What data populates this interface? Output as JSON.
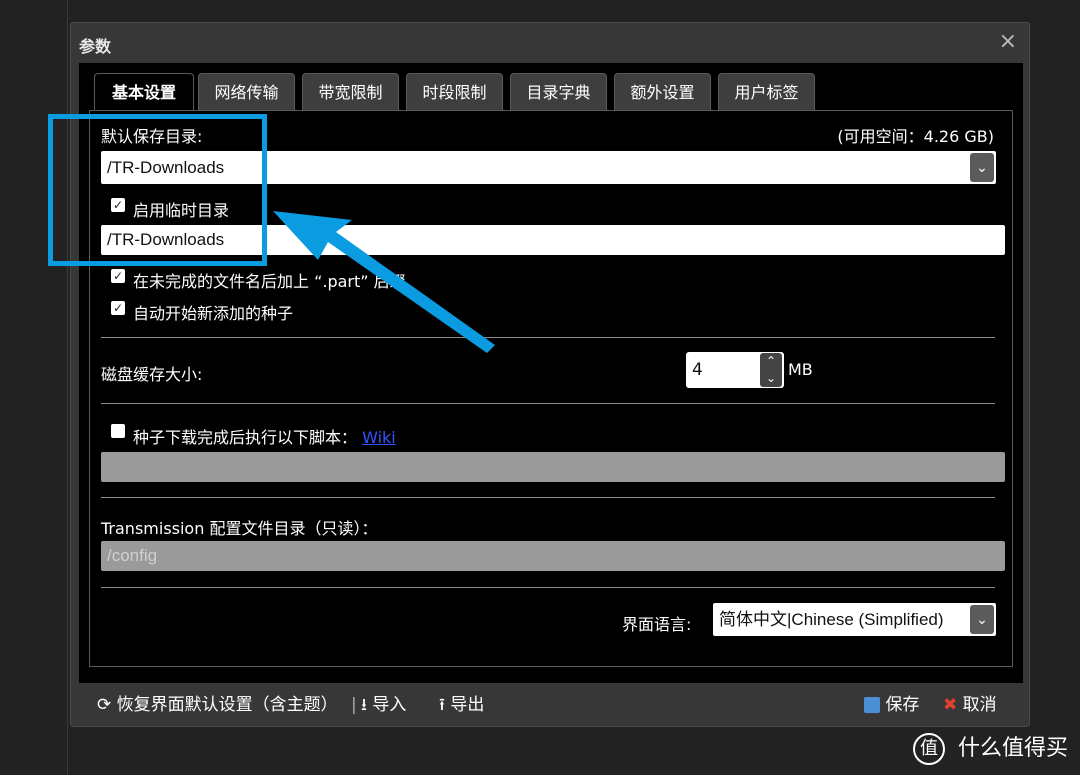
{
  "dialog": {
    "title": "参数",
    "close_icon": "×"
  },
  "tabs": [
    {
      "label": "基本设置"
    },
    {
      "label": "网络传输"
    },
    {
      "label": "带宽限制"
    },
    {
      "label": "时段限制"
    },
    {
      "label": "目录字典"
    },
    {
      "label": "额外设置"
    },
    {
      "label": "用户标签"
    }
  ],
  "basic": {
    "save_dir_label": "默认保存目录:",
    "free_space": "(可用空间：4.26 GB)",
    "save_dir_value": "/TR-Downloads",
    "temp_dir_checkbox_label": "启用临时目录",
    "temp_dir_value": "/TR-Downloads",
    "part_suffix_label": "在未完成的文件名后加上 “.part” 后缀",
    "auto_start_label": "自动开始新添加的种子",
    "disk_cache_label": "磁盘缓存大小:",
    "disk_cache_value": "4",
    "disk_cache_unit": "MB",
    "script_label": "种子下载完成后执行以下脚本：",
    "script_link": "Wiki",
    "script_value": "",
    "config_dir_label": "Transmission 配置文件目录（只读）：",
    "config_dir_value": "/config",
    "lang_label": "界面语言:",
    "lang_value": "简体中文|Chinese (Simplified)"
  },
  "footer": {
    "reset_label": "恢复界面默认设置（含主题）",
    "import_label": "导入",
    "export_label": "导出",
    "save_label": "保存",
    "cancel_label": "取消"
  },
  "watermark": "什么值得买",
  "colors": {
    "accent": "#0a9be0",
    "dialog_bg": "#373737",
    "panel_bg": "#000000"
  }
}
